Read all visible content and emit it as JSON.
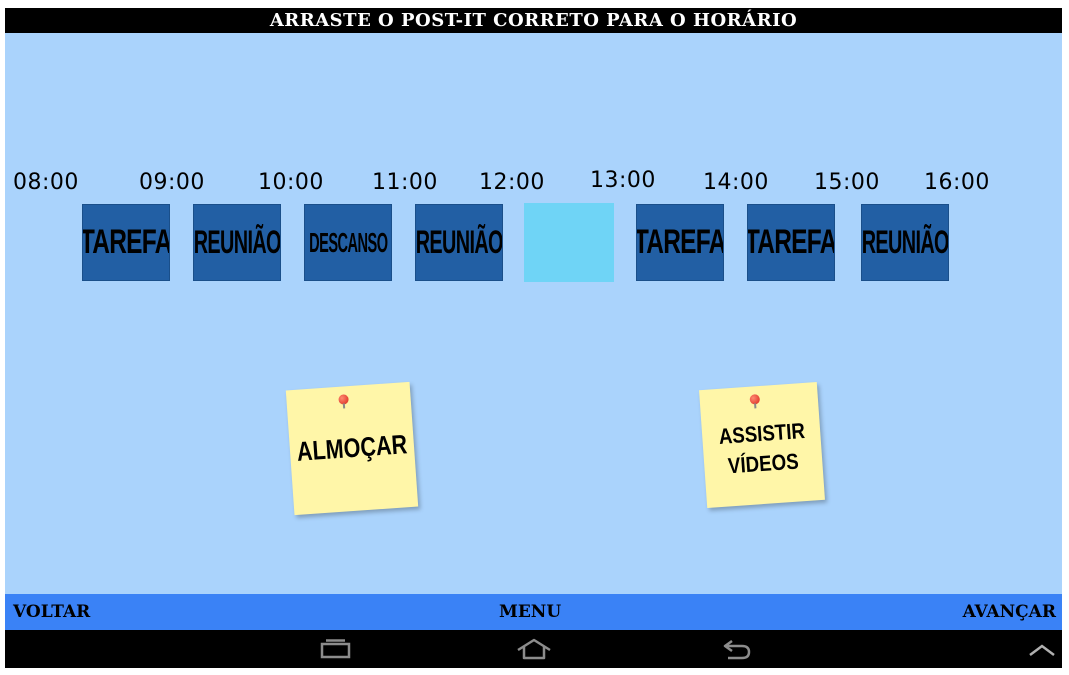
{
  "header": {
    "title": "ARRASTE O POST-IT CORRETO PARA O HORÁRIO"
  },
  "schedule": {
    "times": [
      "08:00",
      "09:00",
      "10:00",
      "11:00",
      "12:00",
      "13:00",
      "14:00",
      "15:00",
      "16:00"
    ],
    "slots": [
      "TAREFA",
      "REUNIÃO",
      "DESCANSO",
      "REUNIÃO",
      "",
      "TAREFA",
      "TAREFA",
      "REUNIÃO"
    ]
  },
  "postits": [
    {
      "label": "ALMOÇAR"
    },
    {
      "label": "ASSISTIR VÍDEOS"
    }
  ],
  "footer": {
    "back_label": "VOLTAR",
    "menu_label": "MENU",
    "next_label": "AVANÇAR"
  },
  "android_nav": {
    "icons": [
      "recent-apps-icon",
      "home-icon",
      "back-icon",
      "chevron-up-icon"
    ]
  },
  "colors": {
    "background": "#aad3fc",
    "slot": "#225fa4",
    "empty_slot": "#6fd4f6",
    "postit": "#fff6a8",
    "footer": "#3a82f6"
  }
}
